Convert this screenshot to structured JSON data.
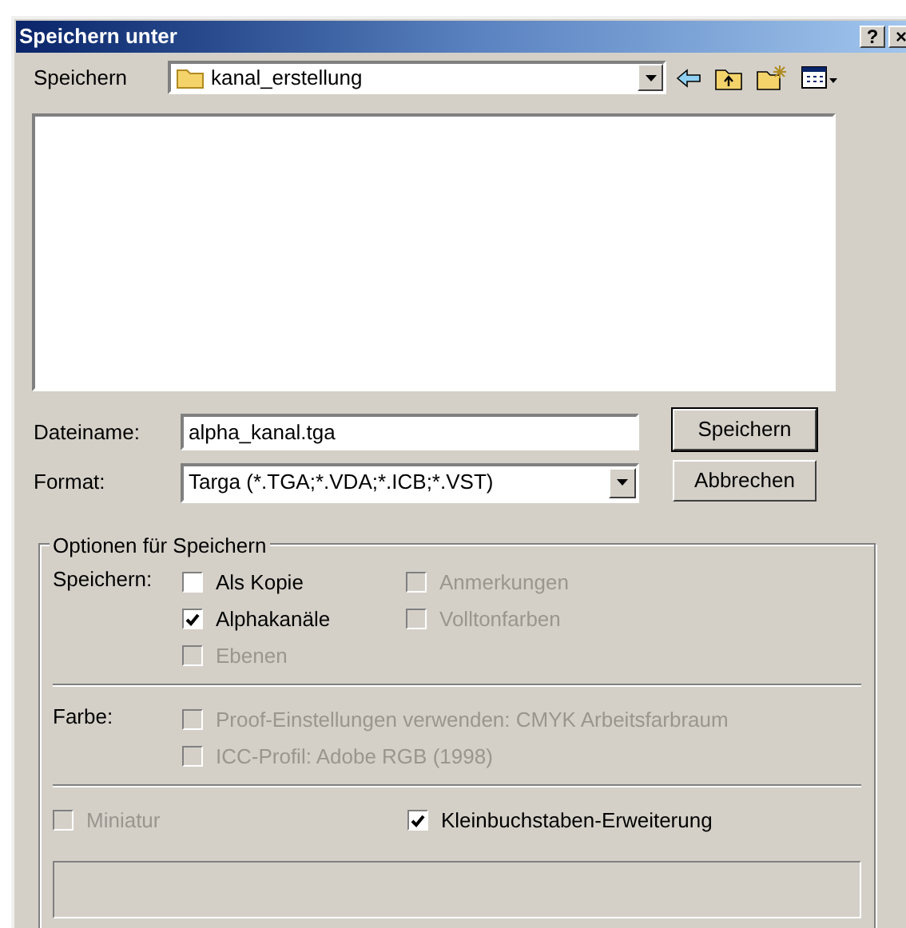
{
  "window": {
    "title": "Speichern unter",
    "title_buttons": [
      "?",
      "×"
    ]
  },
  "save_in": {
    "label": "Speichern",
    "value": "kanal_erstellung"
  },
  "filename": {
    "label": "Dateiname:",
    "value": "alpha_kanal.tga"
  },
  "format": {
    "label": "Format:",
    "value": "Targa (*.TGA;*.VDA;*.ICB;*.VST)"
  },
  "buttons": [
    {
      "label": "Speichern",
      "default": true
    },
    {
      "label": "Abbrechen",
      "default": false
    }
  ],
  "options": {
    "legend": "Optionen für Speichern",
    "sections": [
      {
        "label": "Speichern:",
        "checkboxes": [
          {
            "label": "Als Kopie",
            "checked": false,
            "disabled": false
          },
          {
            "label": "Anmerkungen",
            "checked": false,
            "disabled": true
          },
          {
            "label": "Alphakanäle",
            "checked": true,
            "disabled": false
          },
          {
            "label": "Volltonfarben",
            "checked": false,
            "disabled": true
          },
          {
            "label": "Ebenen",
            "checked": false,
            "disabled": true
          }
        ]
      },
      {
        "label": "Farbe:",
        "checkboxes": [
          {
            "label": "Proof-Einstellungen verwenden: CMYK Arbeitsfarbraum",
            "checked": false,
            "disabled": true
          },
          {
            "label": "ICC-Profil: Adobe RGB (1998)",
            "checked": false,
            "disabled": true
          }
        ]
      }
    ],
    "bottom": [
      {
        "label": "Miniatur",
        "checked": false,
        "disabled": true
      },
      {
        "label": "Kleinbuchstaben-Erweiterung",
        "checked": true,
        "disabled": false
      }
    ]
  }
}
